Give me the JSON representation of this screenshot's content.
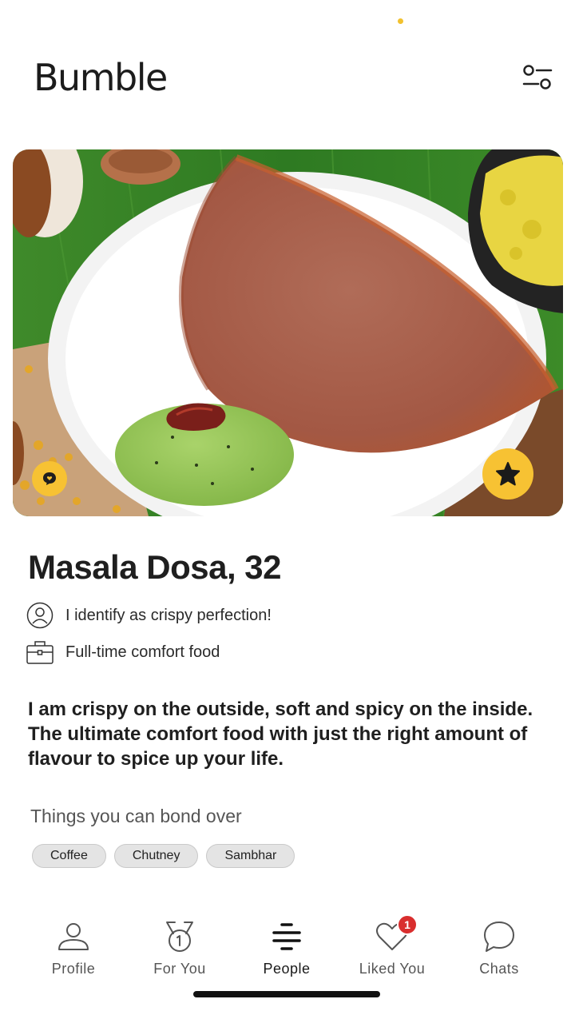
{
  "app": {
    "title": "Bumble"
  },
  "colors": {
    "accent": "#f7c233",
    "notification": "#d92e2e"
  },
  "header": {
    "filter_icon": "filter-sliders-icon"
  },
  "profile": {
    "name_age": "Masala Dosa, 32",
    "gender": "I identify as crispy perfection!",
    "work": "Full-time comfort food",
    "bio": "I am crispy on the outside, soft and spicy on the inside. The ultimate comfort food with just the right amount of flavour to spice up your life.",
    "bond_title": "Things you can bond over",
    "tags": [
      "Coffee",
      "Chutney",
      "Sambhar"
    ]
  },
  "nav": {
    "items": [
      {
        "label": "Profile",
        "icon": "profile-icon"
      },
      {
        "label": "For You",
        "icon": "medal-icon"
      },
      {
        "label": "People",
        "icon": "people-stack-icon",
        "active": true
      },
      {
        "label": "Liked You",
        "icon": "heart-icon",
        "badge": "1"
      },
      {
        "label": "Chats",
        "icon": "chat-bubble-icon"
      }
    ]
  }
}
